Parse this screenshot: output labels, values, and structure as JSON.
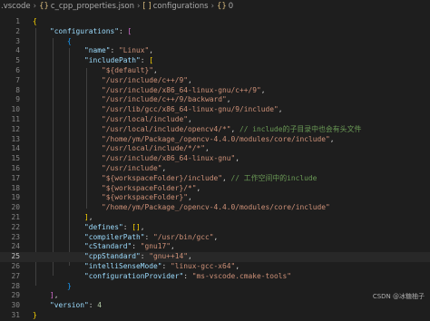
{
  "breadcrumb": {
    "folder": ".vscode",
    "file_icon": "{}",
    "file": "c_cpp_properties.json",
    "array_icon": "[ ]",
    "key": "configurations",
    "obj_icon": "{}",
    "index": "0"
  },
  "editor": {
    "current_line": 25,
    "lines": [
      {
        "n": "1",
        "t": [
          [
            "b1",
            "{"
          ]
        ]
      },
      {
        "n": "2",
        "t": [
          [
            "k",
            "    \"configurations\""
          ],
          [
            "p",
            ": "
          ],
          [
            "b2",
            "["
          ]
        ]
      },
      {
        "n": "3",
        "t": [
          [
            "b3",
            "        {"
          ]
        ]
      },
      {
        "n": "4",
        "t": [
          [
            "k",
            "            \"name\""
          ],
          [
            "p",
            ": "
          ],
          [
            "s",
            "\"Linux\""
          ],
          [
            "p",
            ","
          ]
        ]
      },
      {
        "n": "5",
        "t": [
          [
            "k",
            "            \"includePath\""
          ],
          [
            "p",
            ": "
          ],
          [
            "b1",
            "["
          ]
        ]
      },
      {
        "n": "6",
        "t": [
          [
            "s",
            "                \"${default}\""
          ],
          [
            "p",
            ","
          ]
        ]
      },
      {
        "n": "7",
        "t": [
          [
            "s",
            "                \"/usr/include/c++/9\""
          ],
          [
            "p",
            ","
          ]
        ]
      },
      {
        "n": "8",
        "t": [
          [
            "s",
            "                \"/usr/include/x86_64-linux-gnu/c++/9\""
          ],
          [
            "p",
            ","
          ]
        ]
      },
      {
        "n": "9",
        "t": [
          [
            "s",
            "                \"/usr/include/c++/9/backward\""
          ],
          [
            "p",
            ","
          ]
        ]
      },
      {
        "n": "10",
        "t": [
          [
            "s",
            "                \"/usr/lib/gcc/x86_64-linux-gnu/9/include\""
          ],
          [
            "p",
            ","
          ]
        ]
      },
      {
        "n": "11",
        "t": [
          [
            "s",
            "                \"/usr/local/include\""
          ],
          [
            "p",
            ","
          ]
        ]
      },
      {
        "n": "12",
        "t": [
          [
            "s",
            "                \"/usr/local/include/opencv4/*\""
          ],
          [
            "p",
            ", "
          ],
          [
            "c",
            "// include的子目录中也会有头文件"
          ]
        ]
      },
      {
        "n": "13",
        "t": [
          [
            "s",
            "                \"/home/ym/Package_/opencv-4.4.0/modules/core/include\""
          ],
          [
            "p",
            ","
          ]
        ]
      },
      {
        "n": "14",
        "t": [
          [
            "s",
            "                \"/usr/local/include/*/*\""
          ],
          [
            "p",
            ","
          ]
        ]
      },
      {
        "n": "15",
        "t": [
          [
            "s",
            "                \"/usr/include/x86_64-linux-gnu\""
          ],
          [
            "p",
            ","
          ]
        ]
      },
      {
        "n": "16",
        "t": [
          [
            "s",
            "                \"/usr/include\""
          ],
          [
            "p",
            ","
          ]
        ]
      },
      {
        "n": "17",
        "t": [
          [
            "s",
            "                \"${workspaceFolder}/include\""
          ],
          [
            "p",
            ", "
          ],
          [
            "c",
            "// 工作空间中的include"
          ]
        ]
      },
      {
        "n": "18",
        "t": [
          [
            "s",
            "                \"${workspaceFolder}/*\""
          ],
          [
            "p",
            ","
          ]
        ]
      },
      {
        "n": "19",
        "t": [
          [
            "s",
            "                \"${workspaceFolder}\""
          ],
          [
            "p",
            ","
          ]
        ]
      },
      {
        "n": "20",
        "t": [
          [
            "s",
            "                \"/home/ym/Package_/opencv-4.4.0/modules/core/include\""
          ]
        ]
      },
      {
        "n": "21",
        "t": [
          [
            "b1",
            "            ]"
          ],
          [
            "p",
            ","
          ]
        ]
      },
      {
        "n": "22",
        "t": [
          [
            "k",
            "            \"defines\""
          ],
          [
            "p",
            ": "
          ],
          [
            "b1",
            "[]"
          ],
          [
            "p",
            ","
          ]
        ]
      },
      {
        "n": "23",
        "t": [
          [
            "k",
            "            \"compilerPath\""
          ],
          [
            "p",
            ": "
          ],
          [
            "s",
            "\"/usr/bin/gcc\""
          ],
          [
            "p",
            ","
          ]
        ]
      },
      {
        "n": "24",
        "t": [
          [
            "k",
            "            \"cStandard\""
          ],
          [
            "p",
            ": "
          ],
          [
            "s",
            "\"gnu17\""
          ],
          [
            "p",
            ","
          ]
        ]
      },
      {
        "n": "25",
        "t": [
          [
            "k",
            "            \"cppStandard\""
          ],
          [
            "p",
            ": "
          ],
          [
            "s",
            "\"gnu++14\""
          ],
          [
            "p",
            ","
          ]
        ]
      },
      {
        "n": "26",
        "t": [
          [
            "k",
            "            \"intelliSenseMode\""
          ],
          [
            "p",
            ": "
          ],
          [
            "s",
            "\"linux-gcc-x64\""
          ],
          [
            "p",
            ","
          ]
        ]
      },
      {
        "n": "27",
        "t": [
          [
            "k",
            "            \"configurationProvider\""
          ],
          [
            "p",
            ": "
          ],
          [
            "s",
            "\"ms-vscode.cmake-tools\""
          ]
        ]
      },
      {
        "n": "28",
        "t": [
          [
            "b3",
            "        }"
          ]
        ]
      },
      {
        "n": "29",
        "t": [
          [
            "b2",
            "    ]"
          ],
          [
            "p",
            ","
          ]
        ]
      },
      {
        "n": "30",
        "t": [
          [
            "k",
            "    \"version\""
          ],
          [
            "p",
            ": "
          ],
          [
            "n",
            "4"
          ]
        ]
      },
      {
        "n": "31",
        "t": [
          [
            "b1",
            "}"
          ]
        ]
      }
    ]
  },
  "watermark": "CSDN @冰糖柚子"
}
